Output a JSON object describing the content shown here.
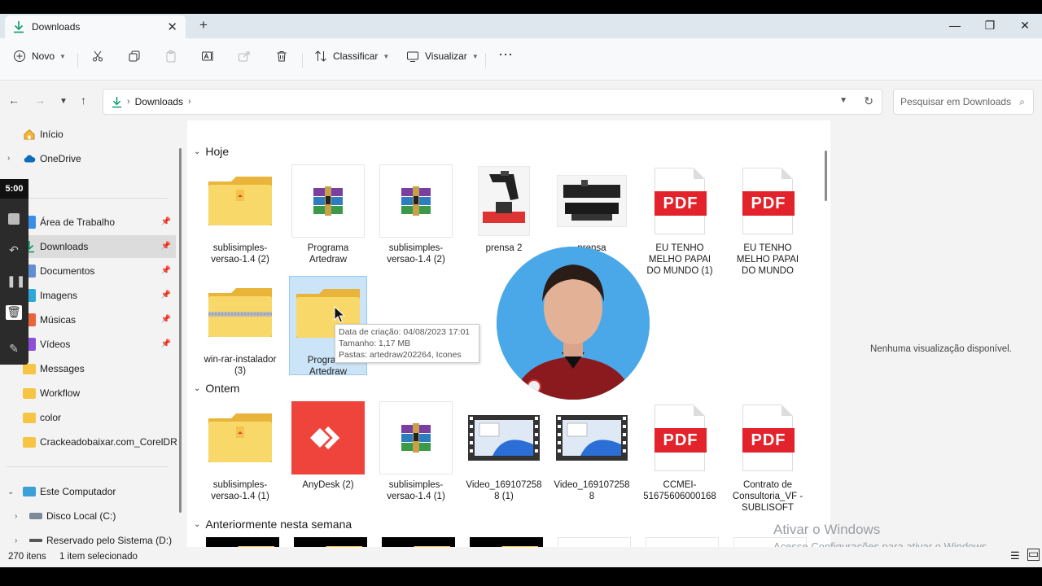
{
  "tab": {
    "title": "Downloads"
  },
  "toolbar": {
    "new_label": "Novo",
    "sort_label": "Classificar",
    "view_label": "Visualizar"
  },
  "address": {
    "crumb": "Downloads"
  },
  "search": {
    "placeholder": "Pesquisar em Downloads"
  },
  "sidebar": {
    "items": [
      {
        "label": "Início"
      },
      {
        "label": "OneDrive"
      },
      {
        "label": "Área de Trabalho"
      },
      {
        "label": "Downloads"
      },
      {
        "label": "Documentos"
      },
      {
        "label": "Imagens"
      },
      {
        "label": "Músicas"
      },
      {
        "label": "Vídeos"
      },
      {
        "label": "Messages"
      },
      {
        "label": "Workflow"
      },
      {
        "label": "color"
      },
      {
        "label": "Crackeadobaixar.com_CorelDRAW"
      },
      {
        "label": "Este Computador"
      },
      {
        "label": "Disco Local (C:)"
      },
      {
        "label": "Reservado pelo Sistema (D:)"
      }
    ]
  },
  "groups": {
    "today": "Hoje",
    "yesterday": "Ontem",
    "earlier": "Anteriormente nesta semana"
  },
  "files_today": [
    {
      "name": "sublisimples-versao-1.4 (2)",
      "icon": "zip-folder"
    },
    {
      "name": "Programa Artedraw",
      "icon": "winrar"
    },
    {
      "name": "sublisimples-versao-1.4 (2)",
      "icon": "winrar"
    },
    {
      "name": "prensa 2",
      "icon": "photo-press-vertical"
    },
    {
      "name": "prensa",
      "icon": "photo-press-flat"
    },
    {
      "name": "EU TENHO MELHO PAPAI DO MUNDO (1)",
      "icon": "pdf"
    },
    {
      "name": "EU TENHO MELHO PAPAI DO MUNDO",
      "icon": "pdf"
    },
    {
      "name": "win-rar-instalador (3)",
      "icon": "zip-folder"
    },
    {
      "name": "Programa Artedraw",
      "icon": "folder"
    }
  ],
  "files_yesterday": [
    {
      "name": "sublisimples-versao-1.4 (1)",
      "icon": "zip-folder"
    },
    {
      "name": "AnyDesk (2)",
      "icon": "anydesk"
    },
    {
      "name": "sublisimples-versao-1.4 (1)",
      "icon": "winrar"
    },
    {
      "name": "Video_1691072588 (1)",
      "icon": "video"
    },
    {
      "name": "Video_1691072588",
      "icon": "video"
    },
    {
      "name": "CCMEI-51675606000168",
      "icon": "pdf"
    },
    {
      "name": "Contrato de Consultoria_VF - SUBLISOFT",
      "icon": "pdf"
    }
  ],
  "pdf_badge": "PDF",
  "tooltip": {
    "line1": "Data de criação: 04/08/2023 17:01",
    "line2": "Tamanho: 1,17 MB",
    "line3": "Pastas: artedraw202264, Icones"
  },
  "preview": {
    "message": "Nenhuma visualização disponível."
  },
  "watermark": {
    "title": "Ativar o Windows",
    "subtitle": "Acesse Configurações para ativar o Windows."
  },
  "status": {
    "count": "270 itens",
    "selected": "1 item selecionado"
  },
  "recorder": {
    "time": "5:00"
  },
  "colors": {
    "accent": "#0067c0",
    "folder": "#f6c543",
    "pdf": "#e3232b",
    "anydesk": "#ef443b"
  }
}
